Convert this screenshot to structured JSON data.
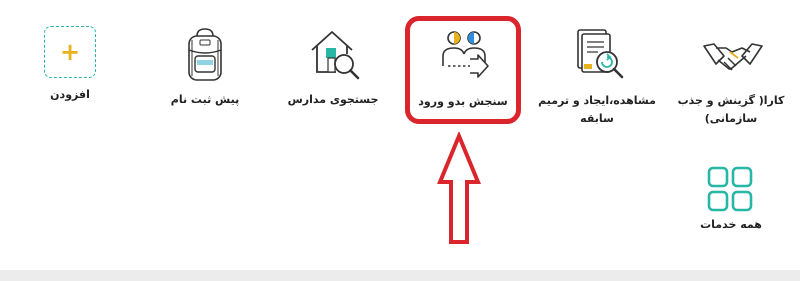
{
  "services": {
    "add": {
      "label": "افزودن",
      "icon": "plus-icon"
    },
    "preregistration": {
      "label": "پیش ثبت نام",
      "icon": "backpack-icon"
    },
    "school_search": {
      "label": "جستجوی مدارس",
      "icon": "house-search-icon"
    },
    "entry_assessment": {
      "label": "سنجش بدو ورود",
      "icon": "people-arrow-icon"
    },
    "history": {
      "label_line1": "مشاهده،ایجاد و ترمیم",
      "label_line2": "سابقه",
      "icon": "document-search-icon"
    },
    "kara": {
      "label_line1": "کارا( گزینش و جذب",
      "label_line2": "سازمانی)",
      "icon": "handshake-icon"
    },
    "all_services": {
      "label": "همه خدمات",
      "icon": "grid-icon"
    }
  },
  "colors": {
    "teal": "#27b7a4",
    "highlight_red": "#d9252b",
    "yellow": "#e8b11e",
    "blue": "#2f8fd8"
  }
}
